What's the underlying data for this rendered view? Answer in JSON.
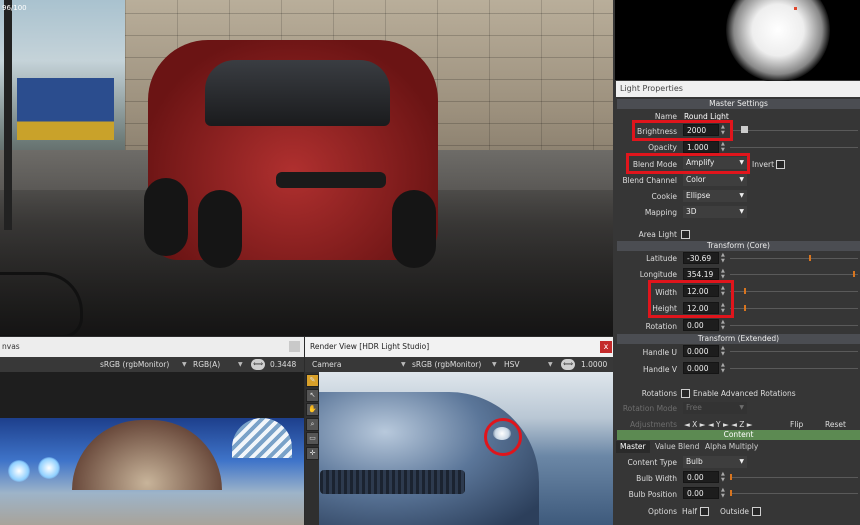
{
  "viewport": {
    "frame_label": "96/100"
  },
  "light_properties": {
    "title": "Light Properties",
    "master_settings": "Master Settings",
    "name_label": "Name",
    "name_value": "Round Light",
    "brightness_label": "Brightness",
    "brightness_value": "2000",
    "opacity_label": "Opacity",
    "opacity_value": "1.000",
    "blend_mode_label": "Blend Mode",
    "blend_mode_value": "Amplify",
    "invert_label": "Invert",
    "blend_channel_label": "Blend Channel",
    "blend_channel_value": "Color",
    "cookie_label": "Cookie",
    "cookie_value": "Ellipse",
    "mapping_label": "Mapping",
    "mapping_value": "3D",
    "area_light_label": "Area Light",
    "transform_core": "Transform (Core)",
    "latitude_label": "Latitude",
    "latitude_value": "-30.69",
    "longitude_label": "Longitude",
    "longitude_value": "354.19",
    "width_label": "Width",
    "width_value": "12.00",
    "height_label": "Height",
    "height_value": "12.00",
    "rotation_label": "Rotation",
    "rotation_value": "0.00",
    "transform_extended": "Transform (Extended)",
    "handle_u_label": "Handle U",
    "handle_u_value": "0.000",
    "handle_v_label": "Handle V",
    "handle_v_value": "0.000",
    "rotations_label": "Rotations",
    "advanced_rotations_label": "Enable Advanced Rotations",
    "rotation_mode_label": "Rotation Mode",
    "rotation_mode_value": "Free",
    "adjustments_label": "Adjustments",
    "flip_label": "Flip",
    "reset_label": "Reset",
    "content_header": "Content",
    "tabs": [
      "Master",
      "Value Blend",
      "Alpha Multiply"
    ],
    "content_type_label": "Content Type",
    "content_type_value": "Bulb",
    "bulb_width_label": "Bulb Width",
    "bulb_width_value": "0.00",
    "bulb_position_label": "Bulb Position",
    "bulb_position_value": "0.00",
    "options_label": "Options",
    "half_label": "Half",
    "outside_label": "Outside"
  },
  "canvas": {
    "title": "nvas",
    "color_space": "sRGB (rgbMonitor)",
    "channels": "RGB(A)",
    "zoom": "0.3448"
  },
  "render_view": {
    "title": "Render View [HDR Light Studio]",
    "close": "x",
    "camera": "Camera",
    "color_space": "sRGB (rgbMonitor)",
    "mode": "HSV",
    "zoom": "1.0000"
  },
  "colors": {
    "highlight_red": "#e0151c",
    "accent_orange": "#d8751f",
    "content_green": "#5c8a52"
  }
}
